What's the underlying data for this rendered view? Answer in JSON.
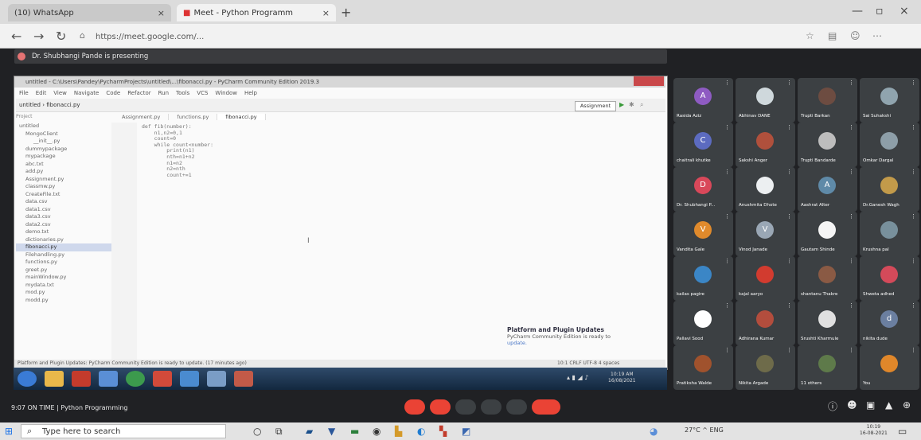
{
  "browser": {
    "tabs": [
      {
        "label": "(10) WhatsApp",
        "active": false
      },
      {
        "label": "Meet - Python Programm",
        "active": true
      }
    ],
    "url": "https://meet.google.com/..."
  },
  "meet": {
    "presenting_banner": "Dr. Shubhangi Pande is presenting",
    "meeting_info": "9:07 ON TIME | Python Programming",
    "participants": [
      {
        "name": "Rasida Aziz",
        "initial": "A",
        "color": "#8e5bc2"
      },
      {
        "name": "Abhinav DANE",
        "initial": "",
        "color": "#cfd8dc"
      },
      {
        "name": "Trupti Barkan",
        "initial": "",
        "color": "#6d4c41"
      },
      {
        "name": "Sai Suhakshi",
        "initial": "",
        "color": "#90a4ae"
      },
      {
        "name": "chaitrali khutke",
        "initial": "C",
        "color": "#5c6bc0"
      },
      {
        "name": "Sakshi Anger",
        "initial": "",
        "color": "#b0503c"
      },
      {
        "name": "Trupti Bandarde",
        "initial": "",
        "color": "#bdbdbd"
      },
      {
        "name": "Omkar Dargal",
        "initial": "",
        "color": "#8d9ea8"
      },
      {
        "name": "Dr. Shubhangi P...",
        "initial": "D",
        "color": "#d9485a"
      },
      {
        "name": "Anushmita Dhote",
        "initial": "",
        "color": "#eceff1"
      },
      {
        "name": "Aashrat Alter",
        "initial": "A",
        "color": "#5f8aa8"
      },
      {
        "name": "Dr.Ganesh Wagh",
        "initial": "",
        "color": "#c29a4a"
      },
      {
        "name": "Vandita Gale",
        "initial": "V",
        "color": "#e08a2c"
      },
      {
        "name": "Vinod Janade",
        "initial": "V",
        "color": "#9aa7b5"
      },
      {
        "name": "Gautam Shinde",
        "initial": "",
        "color": "#f5f5f5"
      },
      {
        "name": "Krushna pal",
        "initial": "",
        "color": "#78909c"
      },
      {
        "name": "kailas pagire",
        "initial": "",
        "color": "#3b86c6"
      },
      {
        "name": "kajal aaryo",
        "initial": "",
        "color": "#d23b2f"
      },
      {
        "name": "shantanu Thakre",
        "initial": "",
        "color": "#8a5a44"
      },
      {
        "name": "Shweta adhed",
        "initial": "",
        "color": "#d44a5a"
      },
      {
        "name": "Pallavi Sood",
        "initial": "",
        "color": "#ffffff"
      },
      {
        "name": "Adhirana Kumar",
        "initial": "",
        "color": "#b34d3d"
      },
      {
        "name": "Srushti Kharmule",
        "initial": "",
        "color": "#e0e0e0"
      },
      {
        "name": "nikita dude",
        "initial": "d",
        "color": "#6b7fa0"
      },
      {
        "name": "Pratiksha Walde",
        "initial": "",
        "color": "#a0522d"
      },
      {
        "name": "Nikita Argade",
        "initial": "",
        "color": "#6e6b4a"
      },
      {
        "name": "11 others",
        "initial": "",
        "color": "#5e7a4a"
      },
      {
        "name": "You",
        "initial": "",
        "color": "#e0872a"
      }
    ]
  },
  "pycharm": {
    "title": "untitled - C:\\Users\\Pandey\\PycharmProjects\\untitled\\...\\fibonacci.py - PyCharm Community Edition 2019.3",
    "menu": [
      "File",
      "Edit",
      "View",
      "Navigate",
      "Code",
      "Refactor",
      "Run",
      "Tools",
      "VCS",
      "Window",
      "Help"
    ],
    "breadcrumb": "untitled › fibonacci.py",
    "run_config": "Assignment",
    "project_label": "Project",
    "editor_tabs": [
      "Assignment.py",
      "functions.py",
      "fibonacci.py"
    ],
    "tree": [
      "untitled",
      "MongoClient",
      "__init__.py",
      "dummypackage",
      "mypackage",
      "abc.txt",
      "add.py",
      "Assignment.py",
      "classmw.py",
      "CreateFile.txt",
      "data.csv",
      "data1.csv",
      "data3.csv",
      "data2.csv",
      "demo.txt",
      "dictionaries.py",
      "fibonacci.py",
      "Filehandling.py",
      "functions.py",
      "greet.py",
      "mainWindow.py",
      "mydata.txt",
      "mod.py",
      "modd.py"
    ],
    "code": [
      "def fib(number):",
      "    n1,n2=0,1",
      "    count=0",
      "    while count<number:",
      "        print(n1)",
      "        nth=n1+n2",
      "        n1=n2",
      "        n2=nth",
      "        count+=1"
    ],
    "notification": {
      "title": "Platform and Plugin Updates",
      "body": "PyCharm Community Edition is ready to",
      "link": "update."
    },
    "status": "Platform and Plugin Updates: PyCharm Community Edition is ready to update. (17 minutes ago)",
    "position": "10:1  CRLF  UTF-8  4 spaces",
    "clock_time": "10:19 AM",
    "clock_date": "16/08/2021"
  },
  "windows": {
    "search_placeholder": "Type here to search",
    "tray": "27°C  ^  ENG",
    "clock_time": "10:19",
    "clock_date": "16-08-2021"
  }
}
